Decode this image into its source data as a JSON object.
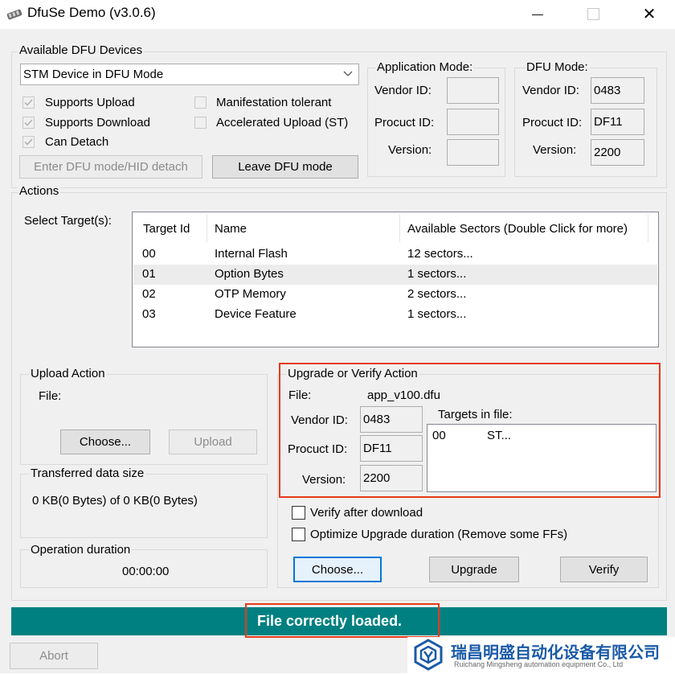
{
  "window": {
    "title": "DfuSe Demo (v3.0.6)",
    "minimize_glyph": "—",
    "close_glyph": "✕"
  },
  "devices": {
    "group_label": "Available DFU Devices",
    "selected_device": "STM Device in DFU Mode",
    "supports_upload": "Supports Upload",
    "supports_download": "Supports Download",
    "can_detach": "Can Detach",
    "manifestation_tolerant": "Manifestation tolerant",
    "accelerated_upload": "Accelerated Upload (ST)",
    "enter_dfu_button": "Enter DFU mode/HID detach",
    "leave_dfu_button": "Leave DFU mode"
  },
  "app_mode": {
    "group_label": "Application Mode:",
    "vendor_label": "Vendor ID:",
    "product_label": "Procuct ID:",
    "version_label": "Version:",
    "vendor_value": "",
    "product_value": "",
    "version_value": ""
  },
  "dfu_mode": {
    "group_label": "DFU Mode:",
    "vendor_label": "Vendor ID:",
    "product_label": "Procuct ID:",
    "version_label": "Version:",
    "vendor_value": "0483",
    "product_value": "DF11",
    "version_value": "2200"
  },
  "actions": {
    "group_label": "Actions",
    "select_target_label": "Select Target(s):",
    "columns": [
      "Target Id",
      "Name",
      "Available Sectors (Double Click for more)"
    ],
    "targets": [
      {
        "id": "00",
        "name": "Internal Flash",
        "sectors": "12 sectors..."
      },
      {
        "id": "01",
        "name": "Option Bytes",
        "sectors": "1 sectors..."
      },
      {
        "id": "02",
        "name": "OTP Memory",
        "sectors": "2 sectors..."
      },
      {
        "id": "03",
        "name": "Device Feature",
        "sectors": "1 sectors..."
      }
    ],
    "selected_row": 1
  },
  "upload": {
    "group_label": "Upload Action",
    "file_label": "File:",
    "choose_button": "Choose...",
    "upload_button": "Upload"
  },
  "transferred": {
    "group_label": "Transferred data size",
    "value": "0 KB(0 Bytes) of 0 KB(0 Bytes)"
  },
  "duration": {
    "group_label": "Operation duration",
    "value": "00:00:00"
  },
  "upgrade": {
    "group_label": "Upgrade or Verify Action",
    "file_label": "File:",
    "file_value": "app_v100.dfu",
    "vendor_label": "Vendor ID:",
    "vendor_value": "0483",
    "product_label": "Procuct ID:",
    "product_value": "DF11",
    "version_label": "Version:",
    "version_value": "2200",
    "targets_in_file_label": "Targets in file:",
    "targets_in_file": [
      {
        "id": "00",
        "name": "ST..."
      }
    ],
    "verify_after_download": "Verify after download",
    "optimize_upgrade": "Optimize Upgrade duration (Remove some FFs)",
    "choose_button": "Choose...",
    "upgrade_button": "Upgrade",
    "verify_button": "Verify"
  },
  "status": {
    "message": "File correctly loaded."
  },
  "abort_button": "Abort",
  "watermark": {
    "name_zh": "瑞昌明盛自动化设备有限公司",
    "name_en": "Ruichang Mingsheng automation equipment Co., Ltd"
  },
  "colors": {
    "status_bar": "#008080",
    "highlight_box": "#e53b1a",
    "focus_border": "#0078d7",
    "brand_blue": "#1a5aa8"
  }
}
